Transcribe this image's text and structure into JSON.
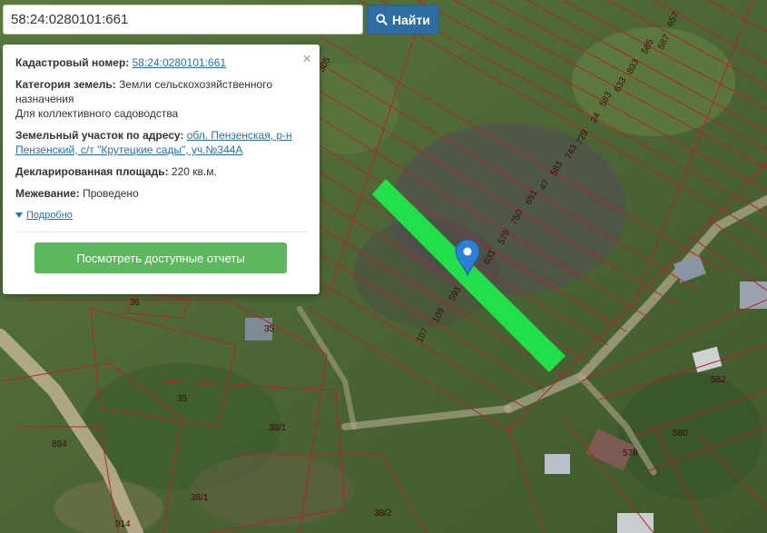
{
  "search": {
    "value": "58:24:0280101:661",
    "button_label": "Найти"
  },
  "popup": {
    "cadastral_label": "Кадастровый номер:",
    "cadastral_value": "58:24:0280101:661",
    "category_label": "Категория земель:",
    "category_value": "Земли сельскохозяйственного назначения",
    "usage": "Для коллективного садоводства",
    "address_label": "Земельный участок по адресу:",
    "address_value": "обл. Пензенская, р-н Пензенский, с/т \"Крутецкие сады\", уч.№344А",
    "area_label": "Декларированная площадь:",
    "area_value": "220 кв.м.",
    "survey_label": "Межевание:",
    "survey_value": "Проведено",
    "details_link": "Подробно",
    "reports_button": "Посмотреть доступные отчеты",
    "close_symbol": "×"
  },
  "map": {
    "parcel_labels": [
      "657",
      "587",
      "585",
      "893",
      "633",
      "583",
      "24",
      "729",
      "743",
      "581",
      "47",
      "651",
      "750",
      "579",
      "631",
      "591",
      "109",
      "107",
      "305",
      "36",
      "35",
      "35",
      "38/1",
      "38/1",
      "38/2",
      "894",
      "914",
      "582",
      "580",
      "578"
    ],
    "highlight_color": "#21e04b",
    "boundary_color": "#b8202a",
    "marker_color": "#2a7fd6"
  }
}
